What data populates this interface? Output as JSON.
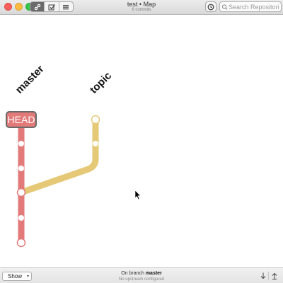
{
  "window": {
    "title": "test • Map",
    "subtitle": "6 commits"
  },
  "toolbar": {
    "view_buttons": [
      {
        "icon": "map-icon",
        "active": true
      },
      {
        "icon": "commit-icon",
        "active": false
      },
      {
        "icon": "list-icon",
        "active": false
      }
    ],
    "history_icon": "clock-icon",
    "search": {
      "placeholder": "Search Repositories",
      "value": ""
    }
  },
  "map": {
    "branches": [
      {
        "name": "master",
        "color": "#e27a7a",
        "head": true
      },
      {
        "name": "topic",
        "color": "#e5c977",
        "head": false
      }
    ],
    "head_label": "HEAD",
    "master_commits": 5,
    "topic_commits": 2
  },
  "bottom": {
    "show_label": "Show",
    "branch_prefix": "On branch",
    "branch_name": "master",
    "upstream": "No upstream configured"
  }
}
